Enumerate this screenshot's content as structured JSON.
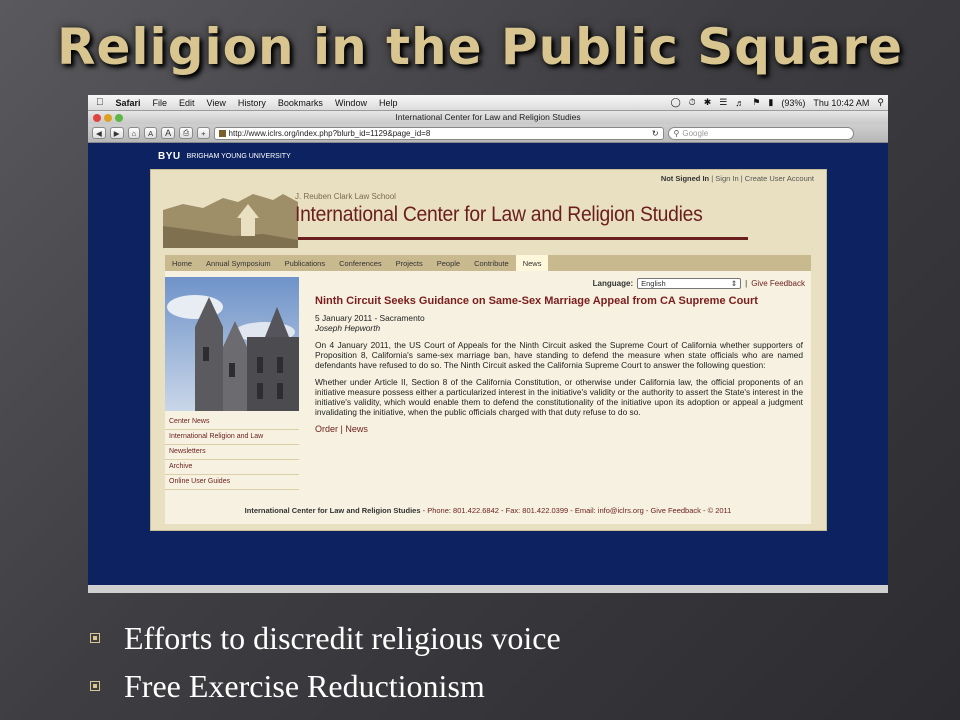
{
  "slide": {
    "title": "Religion in the Public Square",
    "bullets": [
      "Efforts to discredit religious voice",
      "Free Exercise Reductionism"
    ]
  },
  "mac_menubar": {
    "app": "Safari",
    "menus": [
      "File",
      "Edit",
      "View",
      "History",
      "Bookmarks",
      "Window",
      "Help"
    ],
    "battery": "(93%)",
    "clock": "Thu 10:42 AM"
  },
  "browser": {
    "window_title": "International Center for Law and Religion Studies",
    "font_small": "A",
    "font_large": "A",
    "add_button": "+",
    "url": "http://www.iclrs.org/index.php?blurb_id=1129&page_id=8",
    "search_placeholder": "Google"
  },
  "site": {
    "university_mark": "BYU",
    "university_name": "BRIGHAM YOUNG UNIVERSITY",
    "signin": {
      "status": "Not Signed In",
      "sign_in": "Sign In",
      "create": "Create User Account"
    },
    "school": "J. Reuben Clark Law School",
    "org_name": "International Center for Law and Religion Studies",
    "nav": [
      "Home",
      "Annual Symposium",
      "Publications",
      "Conferences",
      "Projects",
      "People",
      "Contribute",
      "News"
    ],
    "language_label": "Language:",
    "language_value": "English",
    "give_feedback": "Give Feedback",
    "sidenav": [
      "Center News",
      "International Religion and Law",
      "Newsletters",
      "Archive",
      "Online User Guides"
    ],
    "article": {
      "headline": "Ninth Circuit Seeks Guidance on Same-Sex Marriage Appeal from CA Supreme Court",
      "dateline": "5 January 2011 - Sacramento",
      "author": "Joseph Hepworth",
      "p1": "On 4 January 2011, the US Court of Appeals for the Ninth Circuit asked the Supreme Court of California whether supporters of Proposition 8, California's same-sex marriage ban, have standing to defend the measure when state officials who are named defendants have refused to do so. The Ninth Circuit asked the California Supreme Court to answer the following question:",
      "p2": "Whether under Article II, Section 8 of the California Constitution, or otherwise under California law, the official proponents of an initiative measure possess either a particularized interest in the initiative's validity or the authority to assert the State's interest in the initiative's validity, which would enable them to defend the constitutionality of the initiative upon its adoption or appeal a judgment invalidating the initiative, when the public officials charged with that duty refuse to do so.",
      "link_order": "Order",
      "link_news": "News"
    },
    "footer": {
      "org": "International Center for Law and Religion Studies",
      "phone": "Phone: 801.422.6842",
      "fax": "Fax: 801.422.0399",
      "email": "Email: info@iclrs.org",
      "feedback": "Give Feedback",
      "copyright": "© 2011"
    }
  },
  "colors": {
    "title_gold": "#d9c58f",
    "site_navy": "#0d2260",
    "headline_red": "#7a1d1d"
  }
}
